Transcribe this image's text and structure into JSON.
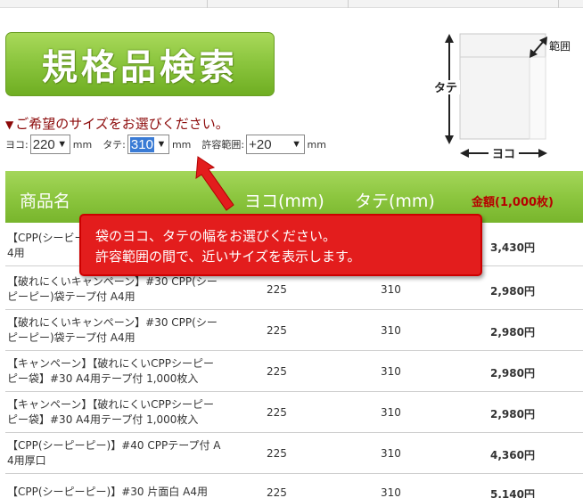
{
  "page": {
    "banner_title": "規格品検索",
    "instruction": "ご希望のサイズをお選びください。",
    "instruction_marker": "▼",
    "controls": {
      "width_label": "ヨコ:",
      "width_value": "220",
      "height_label": "タテ:",
      "height_value": "310",
      "tolerance_label": "許容範囲:",
      "tolerance_value": "+20",
      "unit": "mm"
    },
    "diagram": {
      "range_label": "範囲",
      "height_label": "タテ",
      "width_label": "ヨコ"
    },
    "callout": {
      "line1": "袋のヨコ、タテの幅をお選びください。",
      "line2": "許容範囲の間で、近いサイズを表示します。"
    }
  },
  "table": {
    "headers": {
      "name": "商品名",
      "width": "ヨコ(mm)",
      "height": "タテ(mm)",
      "price": "金額(1,000枚)"
    },
    "rows": [
      {
        "name": "【CPP(シービー",
        "name2": "4用",
        "width": "",
        "height": "",
        "price": "3,430円"
      },
      {
        "name": "【破れにくいキャンペーン】#30 CPP(シー",
        "name2": "ピーピー)袋テープ付 A4用",
        "width": "225",
        "height": "310",
        "price": "2,980円"
      },
      {
        "name": "【破れにくいキャンペーン】#30 CPP(シー",
        "name2": "ピーピー)袋テープ付 A4用",
        "width": "225",
        "height": "310",
        "price": "2,980円"
      },
      {
        "name": "【キャンペーン】【破れにくいCPPシーピー",
        "name2": "ピー袋】#30 A4用テープ付 1,000枚入",
        "width": "225",
        "height": "310",
        "price": "2,980円"
      },
      {
        "name": "【キャンペーン】【破れにくいCPPシーピー",
        "name2": "ピー袋】#30 A4用テープ付 1,000枚入",
        "width": "225",
        "height": "310",
        "price": "2,980円"
      },
      {
        "name": "【CPP(シーピーピー)】#40 CPPテープ付 A",
        "name2": "4用厚口",
        "width": "225",
        "height": "310",
        "price": "4,360円"
      },
      {
        "name": "【CPP(シーピーピー)】#30 片面白 A4用",
        "name2": "",
        "width": "225",
        "height": "310",
        "price": "5,140円"
      }
    ]
  },
  "colors": {
    "green": "#8cc63f",
    "dark_red": "#8c0a0a",
    "price_red": "#b60000",
    "callout_red": "#e31d1d"
  }
}
